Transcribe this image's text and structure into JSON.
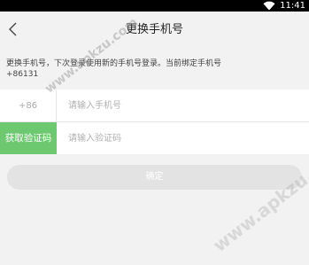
{
  "status_bar": {
    "time": "11:41",
    "wifi_icon": "wifi-icon"
  },
  "header": {
    "back_icon": "chevron-left-icon",
    "title": "更换手机号"
  },
  "description": {
    "line1": "更换手机号，下次登录使用新的手机号登录。当前绑定手机号",
    "line2": "+86131"
  },
  "phone_row": {
    "country_code": "+86",
    "placeholder": "请输入手机号",
    "value": ""
  },
  "code_row": {
    "get_code_label": "获取验证码",
    "placeholder": "请输入验证码",
    "value": ""
  },
  "confirm": {
    "label": "确定"
  },
  "watermark": {
    "text_1": "www.apkzu.com",
    "text_2": "www.apkzu.com"
  },
  "colors": {
    "accent_green": "#6dc96f",
    "confirm_disabled": "#e3e3e3",
    "background": "#f2f2f2"
  }
}
